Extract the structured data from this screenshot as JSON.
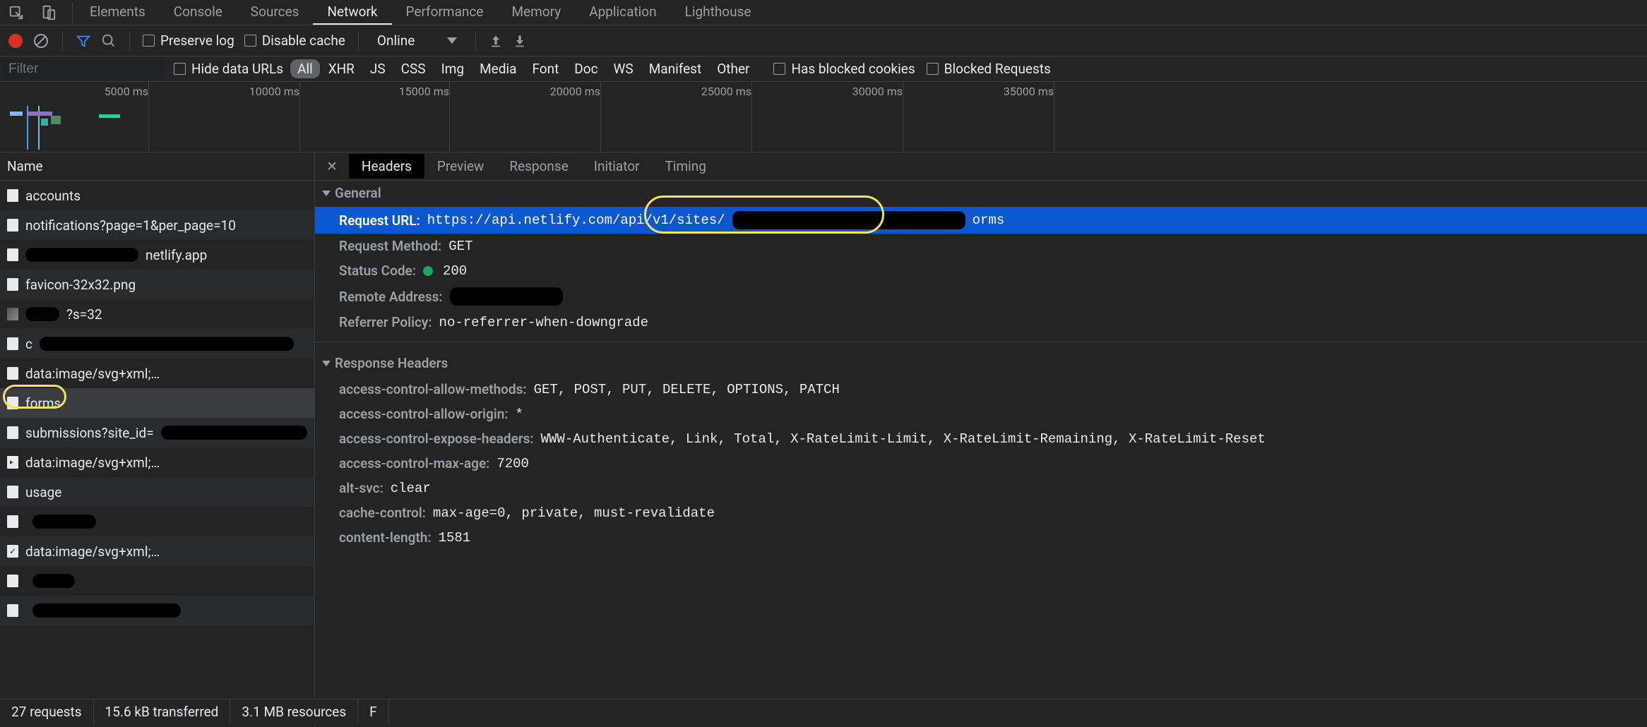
{
  "tabs": [
    "Elements",
    "Console",
    "Sources",
    "Network",
    "Performance",
    "Memory",
    "Application",
    "Lighthouse"
  ],
  "active_tab": "Network",
  "toolbar": {
    "preserve_log": "Preserve log",
    "disable_cache": "Disable cache",
    "throttle": "Online"
  },
  "filter": {
    "placeholder": "Filter",
    "hide_data_urls": "Hide data URLs",
    "types": [
      "All",
      "XHR",
      "JS",
      "CSS",
      "Img",
      "Media",
      "Font",
      "Doc",
      "WS",
      "Manifest",
      "Other"
    ],
    "active_type": "All",
    "has_blocked_cookies": "Has blocked cookies",
    "blocked_requests": "Blocked Requests"
  },
  "timeline": {
    "ticks": [
      "5000 ms",
      "10000 ms",
      "15000 ms",
      "20000 ms",
      "25000 ms",
      "30000 ms",
      "35000 ms"
    ]
  },
  "columns": {
    "name": "Name"
  },
  "requests": [
    {
      "icon": "file",
      "name": "accounts",
      "scribble": false
    },
    {
      "icon": "file",
      "name": "notifications?page=1&per_page=10",
      "scribble": false
    },
    {
      "icon": "file",
      "name": "netlify.app",
      "prefixScribble": 160
    },
    {
      "icon": "file",
      "name": "favicon-32x32.png",
      "scribble": false
    },
    {
      "icon": "image",
      "name": "?s=32",
      "prefixScribble": 48
    },
    {
      "icon": "file",
      "name": "c",
      "suffixScribble": 360
    },
    {
      "icon": "file",
      "name": "data:image/svg+xml;…",
      "scribble": false
    },
    {
      "icon": "file",
      "name": "forms",
      "scribble": false,
      "highlight": true
    },
    {
      "icon": "file",
      "name": "submissions?site_id=",
      "suffixScribble": 230
    },
    {
      "icon": "arrow",
      "name": "data:image/svg+xml;…",
      "scribble": false
    },
    {
      "icon": "file",
      "name": "usage",
      "scribble": false
    },
    {
      "icon": "file",
      "name": "",
      "suffixScribble": 90
    },
    {
      "icon": "check",
      "name": "data:image/svg+xml;…",
      "scribble": false
    },
    {
      "icon": "file",
      "name": "",
      "suffixScribble": 60
    },
    {
      "icon": "file",
      "name": "",
      "suffixScribble": 210
    }
  ],
  "rtabs": [
    "Headers",
    "Preview",
    "Response",
    "Initiator",
    "Timing"
  ],
  "active_rtab": "Headers",
  "details": {
    "sections": {
      "general": "General",
      "response_headers": "Response Headers"
    },
    "general": [
      {
        "k": "Request URL:",
        "v_pre": "https://api.netlify.com/api/v1/sites/",
        "v_post": "orms",
        "redact": 330,
        "annot": true,
        "hl": true
      },
      {
        "k": "Request Method:",
        "v": "GET",
        "mono": true
      },
      {
        "k": "Status Code:",
        "v": "200",
        "mono": true,
        "status": true
      },
      {
        "k": "Remote Address:",
        "v": "",
        "redact": 160
      },
      {
        "k": "Referrer Policy:",
        "v": "no-referrer-when-downgrade",
        "mono": true
      }
    ],
    "response_headers": [
      {
        "k": "access-control-allow-methods:",
        "v": "GET, POST, PUT, DELETE, OPTIONS, PATCH",
        "mono": true
      },
      {
        "k": "access-control-allow-origin:",
        "v": "*",
        "mono": true
      },
      {
        "k": "access-control-expose-headers:",
        "v": "WWW-Authenticate, Link, Total, X-RateLimit-Limit, X-RateLimit-Remaining, X-RateLimit-Reset",
        "mono": true
      },
      {
        "k": "access-control-max-age:",
        "v": "7200",
        "mono": true
      },
      {
        "k": "alt-svc:",
        "v": "clear",
        "mono": true
      },
      {
        "k": "cache-control:",
        "v": "max-age=0, private, must-revalidate",
        "mono": true
      },
      {
        "k": "content-length:",
        "v": "1581",
        "mono": true
      }
    ]
  },
  "status_bar": {
    "requests": "27 requests",
    "transferred": "15.6 kB transferred",
    "resources": "3.1 MB resources",
    "extra": "F"
  }
}
